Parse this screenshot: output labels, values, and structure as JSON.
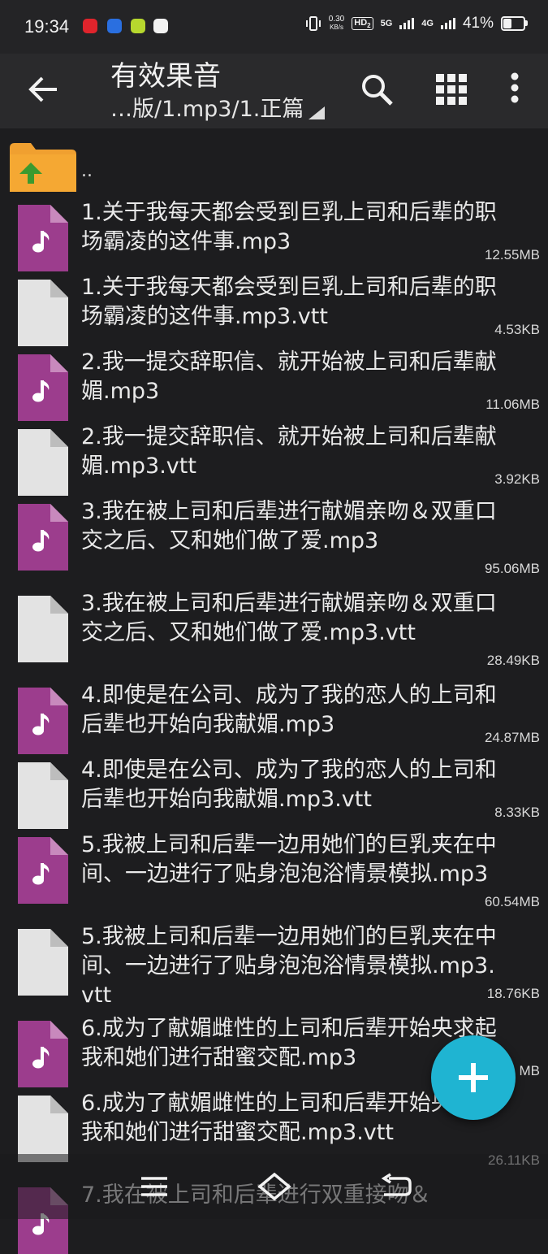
{
  "status_bar": {
    "time": "19:34",
    "net_speed_value": "0.30",
    "net_speed_unit": "KB/s",
    "hd_label": "HD",
    "hd_sub": "2",
    "net_5g": "5G",
    "net_4g": "4G",
    "battery": "41%",
    "app_icons": [
      "netease-music-icon",
      "app-icon-blue",
      "app-icon-green",
      "app-icon-link"
    ]
  },
  "toolbar": {
    "title": "有效果音",
    "path": "…版/1.mp3/1.正篇",
    "icons": [
      "back-arrow-icon",
      "search-icon",
      "grid-view-icon",
      "more-vert-icon"
    ]
  },
  "parent_dir": {
    "label": ".."
  },
  "files": [
    {
      "name": "1.关于我每天都会受到巨乳上司和后辈的职场霸凌的这件事.mp3",
      "size": "12.55MB",
      "type": "audio"
    },
    {
      "name": "1.关于我每天都会受到巨乳上司和后辈的职场霸凌的这件事.mp3.vtt",
      "size": "4.53KB",
      "type": "text"
    },
    {
      "name": "2.我一提交辞职信、就开始被上司和后辈献媚.mp3",
      "size": "11.06MB",
      "type": "audio"
    },
    {
      "name": "2.我一提交辞职信、就开始被上司和后辈献媚.mp3.vtt",
      "size": "3.92KB",
      "type": "text"
    },
    {
      "name": "3.我在被上司和后辈进行献媚亲吻＆双重口交之后、又和她们做了爱.mp3",
      "size": "95.06MB",
      "type": "audio"
    },
    {
      "name": "3.我在被上司和后辈进行献媚亲吻＆双重口交之后、又和她们做了爱.mp3.vtt",
      "size": "28.49KB",
      "type": "text"
    },
    {
      "name": "4.即使是在公司、成为了我的恋人的上司和后辈也开始向我献媚.mp3",
      "size": "24.87MB",
      "type": "audio"
    },
    {
      "name": "4.即使是在公司、成为了我的恋人的上司和后辈也开始向我献媚.mp3.vtt",
      "size": "8.33KB",
      "type": "text"
    },
    {
      "name": "5.我被上司和后辈一边用她们的巨乳夹在中间、一边进行了贴身泡泡浴情景模拟.mp3",
      "size": "60.54MB",
      "type": "audio"
    },
    {
      "name": "5.我被上司和后辈一边用她们的巨乳夹在中间、一边进行了贴身泡泡浴情景模拟.mp3.vtt",
      "size": "18.76KB",
      "type": "text"
    },
    {
      "name": "6.成为了献媚雌性的上司和后辈开始央求起我和她们进行甜蜜交配.mp3",
      "size": "MB",
      "type": "audio"
    },
    {
      "name": "6.成为了献媚雌性的上司和后辈开始央求起我和她们进行甜蜜交配.mp3.vtt",
      "size": "26.11KB",
      "type": "text"
    },
    {
      "name": "7.我在被上司和后辈进行双重接吻＆",
      "size": "",
      "type": "audio"
    }
  ],
  "fab": {
    "icon": "plus-icon"
  },
  "nav": {
    "icons": [
      "menu-icon",
      "home-icon",
      "back-icon"
    ]
  },
  "colors": {
    "audio_icon": "#9c3d8d",
    "fab": "#1fb4d2",
    "folder": "#f0a030",
    "folder_arrow": "#3b9a2f"
  }
}
